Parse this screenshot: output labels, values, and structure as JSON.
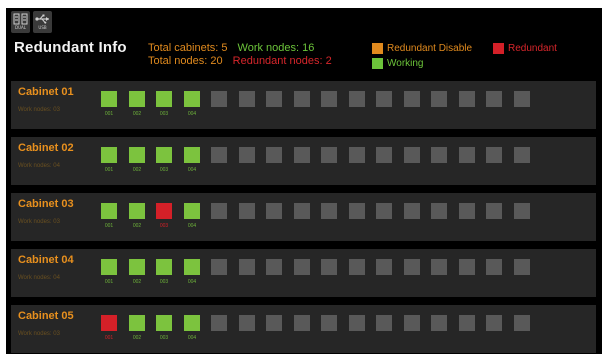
{
  "toolbar": {
    "dual_label": "DUAL",
    "usb_label": "USB"
  },
  "page_title": "Redundant Info",
  "stats": {
    "total_cabinets_label": "Total cabinets:",
    "total_cabinets_value": "5",
    "work_nodes_label": "Work nodes:",
    "work_nodes_value": "16",
    "total_nodes_label": "Total nodes:",
    "total_nodes_value": "20",
    "redundant_nodes_label": "Redundant nodes:",
    "redundant_nodes_value": "2"
  },
  "legend": {
    "disable_label": "Redundant Disable",
    "redundant_label": "Redundant",
    "working_label": "Working"
  },
  "colors": {
    "orange": "#e08a1e",
    "green": "#7cc33e",
    "red": "#d42028",
    "idle": "#595959"
  },
  "cabinets": [
    {
      "name": "Cabinet 01",
      "sub": "Work nodes: 03",
      "nodes": [
        {
          "label": "001",
          "state": "working"
        },
        {
          "label": "002",
          "state": "working"
        },
        {
          "label": "003",
          "state": "working"
        },
        {
          "label": "004",
          "state": "working"
        }
      ]
    },
    {
      "name": "Cabinet 02",
      "sub": "Work nodes: 04",
      "nodes": [
        {
          "label": "001",
          "state": "working"
        },
        {
          "label": "002",
          "state": "working"
        },
        {
          "label": "003",
          "state": "working"
        },
        {
          "label": "004",
          "state": "working"
        }
      ]
    },
    {
      "name": "Cabinet 03",
      "sub": "Work nodes: 03",
      "nodes": [
        {
          "label": "001",
          "state": "working"
        },
        {
          "label": "002",
          "state": "working"
        },
        {
          "label": "003",
          "state": "redundant"
        },
        {
          "label": "004",
          "state": "working"
        }
      ]
    },
    {
      "name": "Cabinet 04",
      "sub": "Work nodes: 04",
      "nodes": [
        {
          "label": "001",
          "state": "working"
        },
        {
          "label": "002",
          "state": "working"
        },
        {
          "label": "003",
          "state": "working"
        },
        {
          "label": "004",
          "state": "working"
        }
      ]
    },
    {
      "name": "Cabinet 05",
      "sub": "Work nodes: 03",
      "nodes": [
        {
          "label": "001",
          "state": "redundant"
        },
        {
          "label": "002",
          "state": "working"
        },
        {
          "label": "003",
          "state": "working"
        },
        {
          "label": "004",
          "state": "working"
        }
      ]
    }
  ],
  "idle_slots_per_cabinet": 12
}
